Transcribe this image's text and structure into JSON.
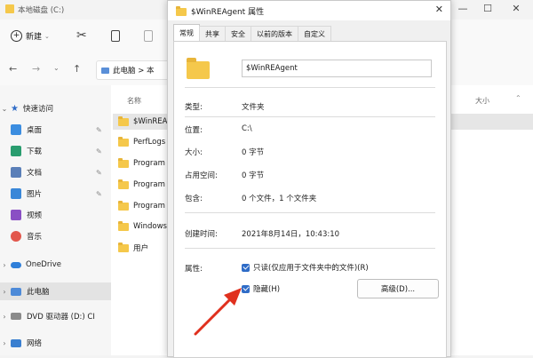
{
  "explorer": {
    "window_title": "本地磁盘 (C:)",
    "new_button": "新建",
    "address_path": "此电脑 > 本",
    "column_name": "名称",
    "column_size": "大小",
    "nav": {
      "quick_access": "快速访问",
      "items": [
        {
          "label": "桌面",
          "icon": "desktop-icon",
          "color": "#3b8de0"
        },
        {
          "label": "下载",
          "icon": "download-icon",
          "color": "#2a9d6f"
        },
        {
          "label": "文档",
          "icon": "documents-icon",
          "color": "#5a7fb8"
        },
        {
          "label": "图片",
          "icon": "pictures-icon",
          "color": "#3a87d8"
        },
        {
          "label": "视频",
          "icon": "videos-icon",
          "color": "#8a4fc4"
        },
        {
          "label": "音乐",
          "icon": "music-icon",
          "color": "#e2574c"
        }
      ],
      "onedrive": "OneDrive",
      "this_pc": "此电脑",
      "dvd": "DVD 驱动器 (D:) CI",
      "network": "网络"
    },
    "files": [
      "$WinREA",
      "PerfLogs",
      "Program",
      "Program",
      "Program",
      "Windows",
      "用户"
    ]
  },
  "dialog": {
    "title": "$WinREAgent 属性",
    "tabs": [
      "常规",
      "共享",
      "安全",
      "以前的版本",
      "自定义"
    ],
    "name_value": "$WinREAgent",
    "type_label": "类型:",
    "type_value": "文件夹",
    "location_label": "位置:",
    "location_value": "C:\\",
    "size_label": "大小:",
    "size_value": "0 字节",
    "disk_size_label": "占用空间:",
    "disk_size_value": "0 字节",
    "contains_label": "包含:",
    "contains_value": "0 个文件，1 个文件夹",
    "created_label": "创建时间:",
    "created_value": "2021年8月14日，10:43:10",
    "attributes_label": "属性:",
    "readonly_label": "只读(仅应用于文件夹中的文件)(R)",
    "hidden_label": "隐藏(H)",
    "advanced_button": "高级(D)...",
    "readonly_checked": true,
    "hidden_checked": true
  },
  "colors": {
    "accent": "#2f6cc7",
    "arrow": "#e0301e",
    "folder": "#f5c84b"
  }
}
